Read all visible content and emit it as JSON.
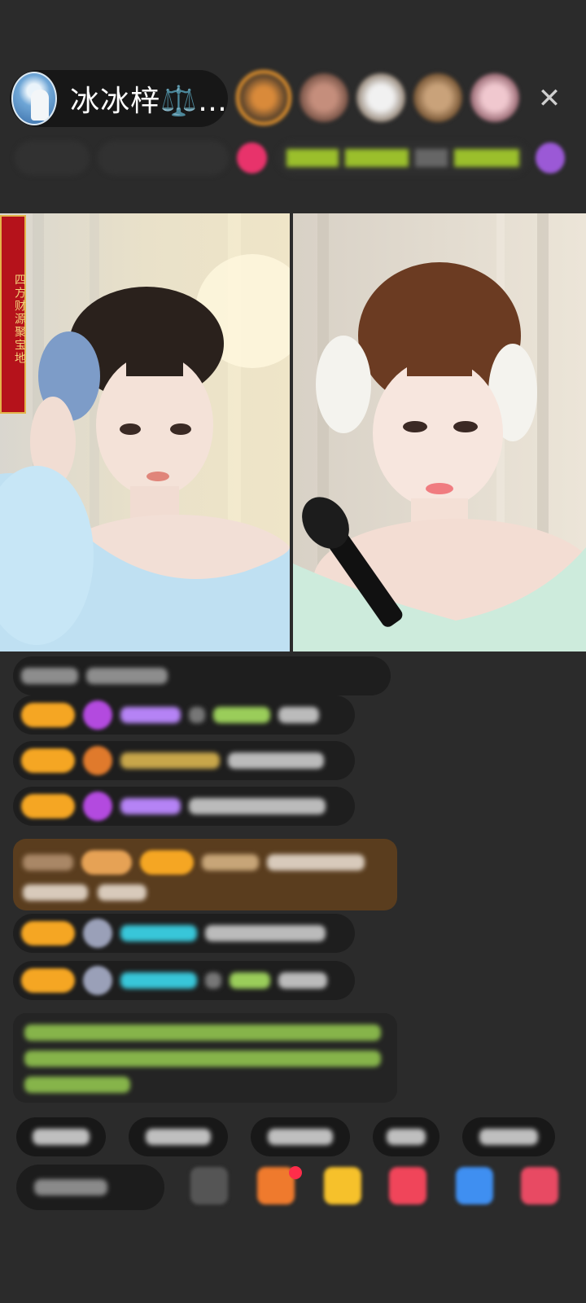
{
  "header": {
    "host_name": "冰冰梓⚖️…",
    "close_glyph": "✕"
  },
  "video": {
    "banner_text": "四方财源聚宝地"
  },
  "colors": {
    "badge": "#f5a623",
    "promo_bg": "#5a3d1e",
    "green_text": "#9acd5a",
    "cyan_text": "#38c6d9",
    "purple_text": "#b583f5",
    "notify_red": "#ff2d4a",
    "top_viewer_ring": "#f09a2e"
  },
  "icons": {
    "close": "close-icon",
    "comment_emoji": "emoji-icon",
    "gift": "gift-icon",
    "gift_box": "gift-box-icon",
    "heart": "heart-icon",
    "share": "share-icon",
    "more": "more-icon"
  }
}
